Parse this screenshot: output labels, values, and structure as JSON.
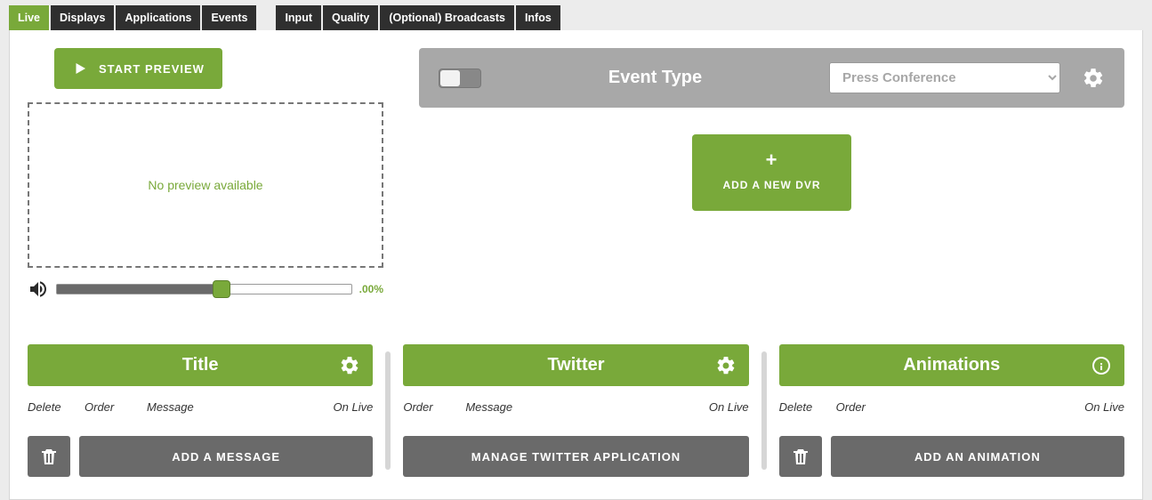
{
  "tabs": {
    "live": "Live",
    "displays": "Displays",
    "applications": "Applications",
    "events": "Events",
    "input": "Input",
    "quality": "Quality",
    "broadcasts": "(Optional) Broadcasts",
    "infos": "Infos"
  },
  "preview": {
    "start_label": "START PREVIEW",
    "no_preview": "No preview available",
    "volume_pct": ".00%"
  },
  "eventbar": {
    "label": "Event Type",
    "selected": "Press Conference"
  },
  "dvr": {
    "add_label": "ADD A NEW DVR"
  },
  "cards": {
    "title": {
      "heading": "Title",
      "cols": {
        "delete": "Delete",
        "order": "Order",
        "message": "Message",
        "onlive": "On Live"
      },
      "action": "ADD A MESSAGE"
    },
    "twitter": {
      "heading": "Twitter",
      "cols": {
        "order": "Order",
        "message": "Message",
        "onlive": "On Live"
      },
      "action": "MANAGE TWITTER APPLICATION"
    },
    "animations": {
      "heading": "Animations",
      "cols": {
        "delete": "Delete",
        "order": "Order",
        "onlive": "On Live"
      },
      "action": "ADD AN ANIMATION"
    }
  }
}
